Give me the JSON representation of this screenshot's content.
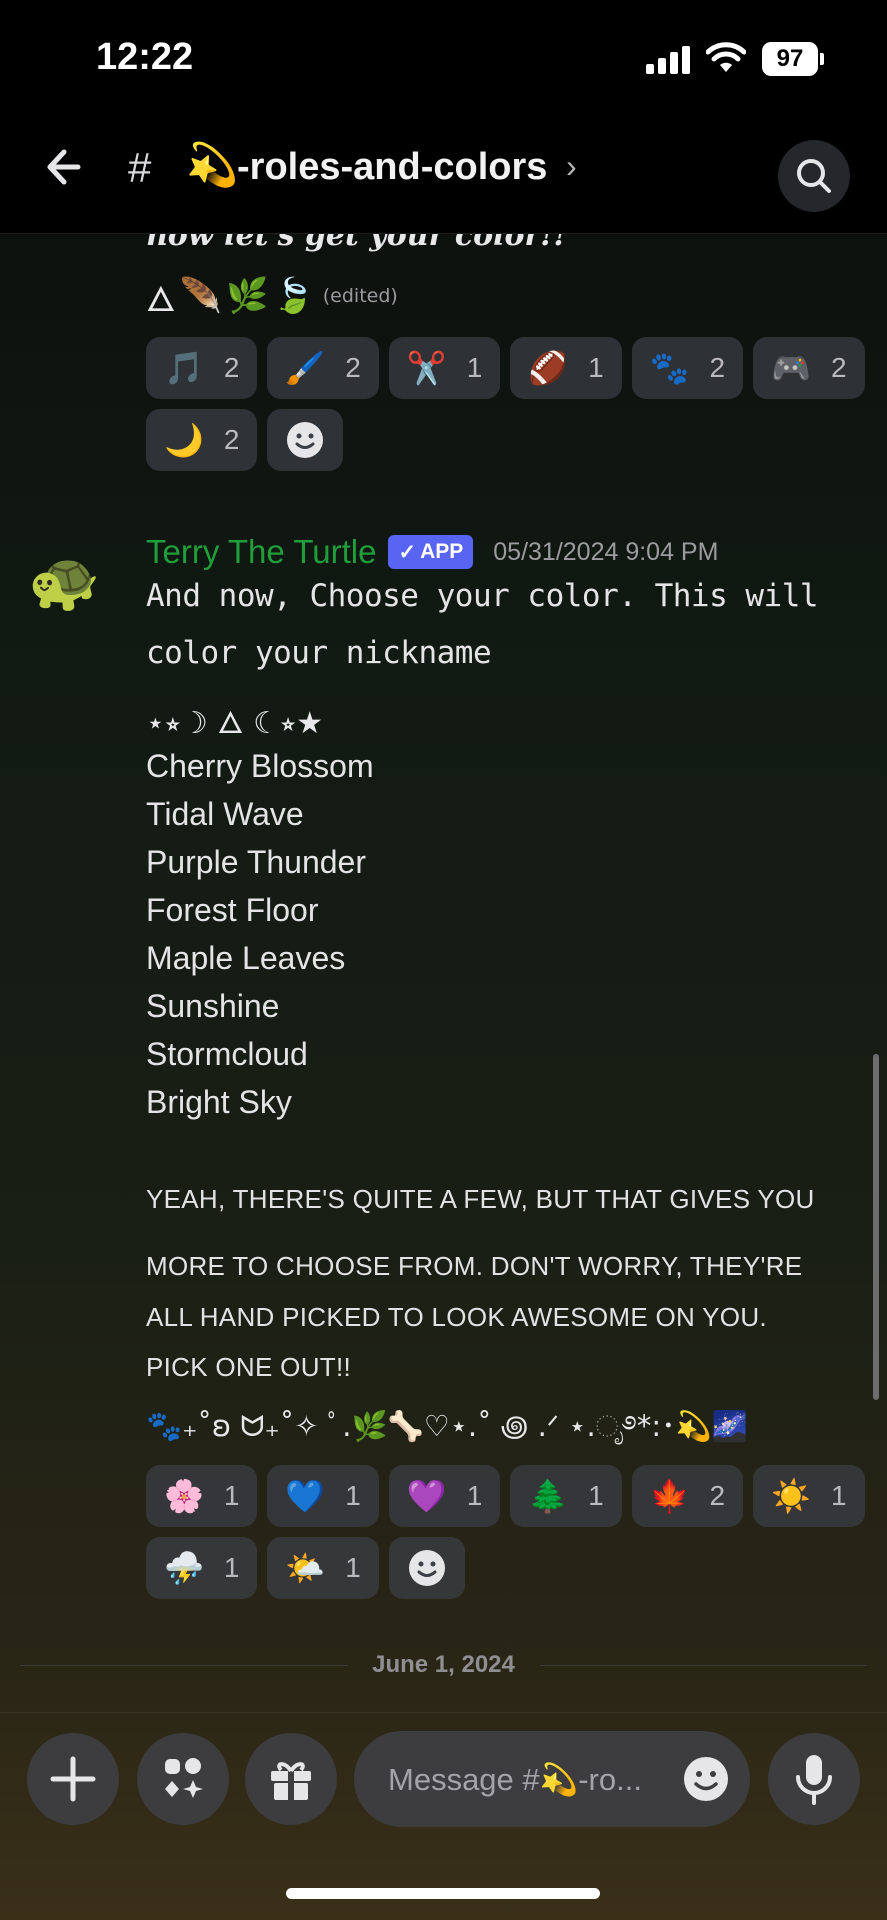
{
  "status_bar": {
    "time": "12:22",
    "battery": "97"
  },
  "header": {
    "hash": "#",
    "channel_emoji": "💫",
    "channel_name": "-roles-and-colors",
    "chevron": "›"
  },
  "previous_message": {
    "title_fragment": "now let's get your color!!",
    "icons": [
      "🜂",
      "🪶",
      "🌿",
      "🍃"
    ],
    "edited": "(edited)",
    "reactions": [
      {
        "emoji": "🎵",
        "count": "2"
      },
      {
        "emoji": "🖌️",
        "count": "2"
      },
      {
        "emoji": "✂️",
        "count": "1"
      },
      {
        "emoji": "🏈",
        "count": "1"
      },
      {
        "emoji": "🐾",
        "count": "2"
      },
      {
        "emoji": "🎮",
        "count": "2"
      },
      {
        "emoji": "🌙",
        "count": "2"
      }
    ]
  },
  "message": {
    "avatar": "🐢",
    "author": "Terry The Turtle",
    "badge": "APP",
    "badge_check": "✓",
    "timestamp": "05/31/2024 9:04 PM",
    "line1": "And now, Choose your color. This will",
    "line2": "color your nickname",
    "decoration1": "⋆⭒☽ 🜂 ☾⭒★",
    "colors": [
      "Cherry Blossom",
      "Tidal Wave",
      "Purple Thunder",
      "Forest Floor",
      "Maple Leaves",
      "Sunshine",
      "Stormcloud",
      "Bright Sky"
    ],
    "note_lines": [
      "YEAH, THERE'S QUITE A FEW, BUT THAT GIVES YOU",
      "MORE TO CHOOSE FROM. DON'T WORRY, THEY'RE",
      "ALL HAND PICKED TO LOOK AWESOME ON YOU.",
      "PICK ONE OUT!!"
    ],
    "decoration2": "🐾₊˚ʚ ᗢ₊˚✧ ﾟ.🌿🦴♡⋆.˚ ꩜ .ᐟ ⋆.ೃ࿔*:･💫🌌",
    "reactions": [
      {
        "emoji": "🌸",
        "count": "1"
      },
      {
        "emoji": "💙",
        "count": "1"
      },
      {
        "emoji": "💜",
        "count": "1"
      },
      {
        "emoji": "🌲",
        "count": "1"
      },
      {
        "emoji": "🍁",
        "count": "2"
      },
      {
        "emoji": "☀️",
        "count": "1"
      },
      {
        "emoji": "⛈️",
        "count": "1"
      },
      {
        "emoji": "🌤️",
        "count": "1"
      }
    ]
  },
  "date_divider": "June 1, 2024",
  "composer": {
    "placeholder": "Message #💫-ro..."
  },
  "icons": {
    "back": "arrow-left-icon",
    "search": "search-icon",
    "add": "plus-icon",
    "apps": "apps-icon",
    "gift": "gift-icon",
    "emoji": "emoji-icon",
    "mic": "microphone-icon"
  },
  "colors": {
    "author": "#1f9e3a",
    "app_badge": "#5865f2"
  }
}
